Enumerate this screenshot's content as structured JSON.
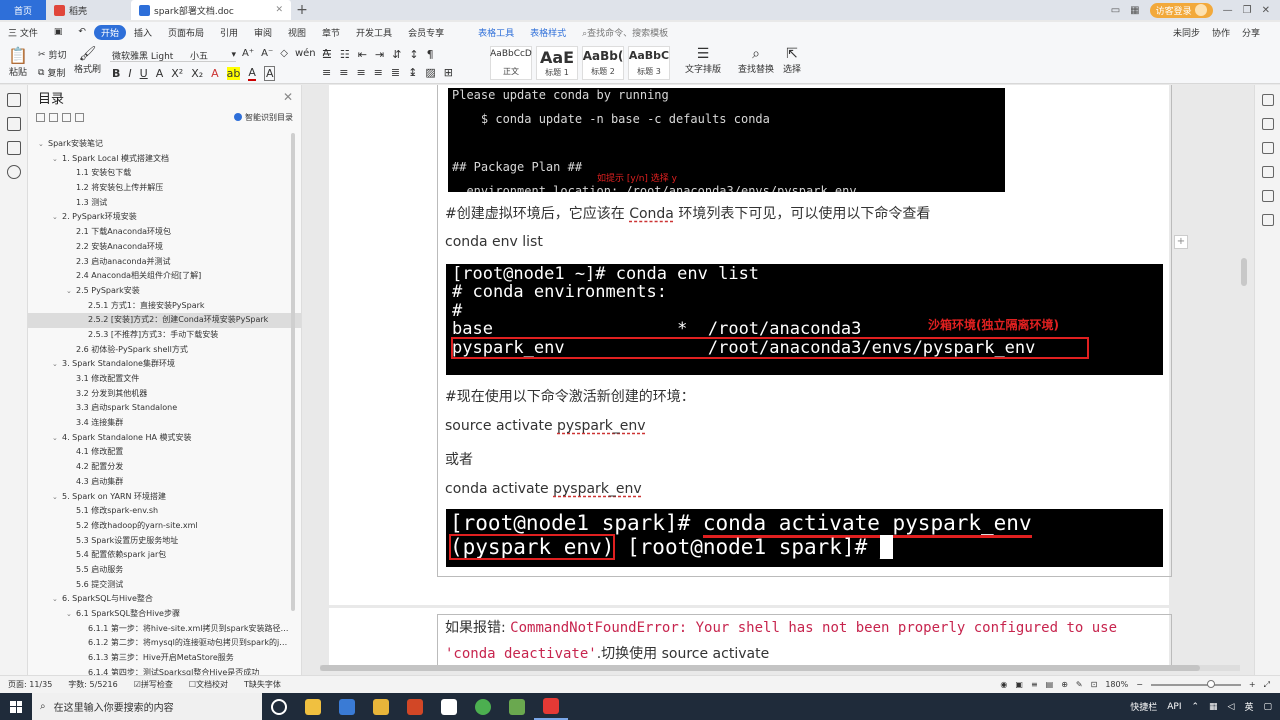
{
  "titlebar": {
    "tabs": [
      {
        "label": "首页"
      },
      {
        "label": "稻壳"
      },
      {
        "label": "spark部署文档.doc"
      }
    ],
    "login_label": "访客登录"
  },
  "menubar": {
    "file": "三 文件",
    "items": [
      "开始",
      "插入",
      "页面布局",
      "引用",
      "审阅",
      "视图",
      "章节",
      "开发工具",
      "会员专享"
    ],
    "active": "开始",
    "context_tabs": [
      "表格工具",
      "表格样式"
    ],
    "search_placeholder": "查找命令、搜索模板",
    "right": [
      "未同步",
      "协作",
      "分享"
    ]
  },
  "ribbon": {
    "paste": "粘贴",
    "cut": "剪切",
    "copy": "复制",
    "format_painter": "格式刷",
    "font_name": "微软雅黑 Light",
    "font_size": "小五",
    "styles": [
      {
        "preview": "AaBbCcD",
        "name": "正文"
      },
      {
        "preview": "AaE",
        "name": "标题 1"
      },
      {
        "preview": "AaBb(",
        "name": "标题 2"
      },
      {
        "preview": "AaBbC",
        "name": "标题 3"
      }
    ],
    "text_layout": "文字排版",
    "find_replace": "查找替换",
    "select": "选择"
  },
  "toc": {
    "title": "目录",
    "smart_label": "智能识别目录",
    "items": [
      {
        "text": "Spark安装笔记",
        "level": 0,
        "caret": "v"
      },
      {
        "text": "1. Spark Local 模式搭建文档",
        "level": 1,
        "caret": "v"
      },
      {
        "text": "1.1 安装包下载",
        "level": 2,
        "caret": ""
      },
      {
        "text": "1.2 将安装包上传并解压",
        "level": 2,
        "caret": ""
      },
      {
        "text": "1.3 测试",
        "level": 2,
        "caret": ""
      },
      {
        "text": "2. PySpark环境安装",
        "level": 1,
        "caret": "v"
      },
      {
        "text": "2.1 下载Anaconda环境包",
        "level": 2,
        "caret": ""
      },
      {
        "text": "2.2 安装Anaconda环境",
        "level": 2,
        "caret": ""
      },
      {
        "text": "2.3 启动anaconda并测试",
        "level": 2,
        "caret": ""
      },
      {
        "text": "2.4 Anaconda相关组件介绍[了解]",
        "level": 2,
        "caret": ""
      },
      {
        "text": "2.5 PySpark安装",
        "level": 2,
        "caret": "v"
      },
      {
        "text": "2.5.1 方式1：直接安装PySpark",
        "level": 3,
        "caret": ""
      },
      {
        "text": "2.5.2 [安装]方式2：创建Conda环境安装PySpark",
        "level": 3,
        "caret": "",
        "selected": true
      },
      {
        "text": "2.5.3 [不推荐]方式3：手动下载安装",
        "level": 3,
        "caret": ""
      },
      {
        "text": "2.6 初体验-PySpark shell方式",
        "level": 2,
        "caret": ""
      },
      {
        "text": "3. Spark Standalone集群环境",
        "level": 1,
        "caret": "v"
      },
      {
        "text": "3.1 修改配置文件",
        "level": 2,
        "caret": ""
      },
      {
        "text": "3.2 分发到其他机器",
        "level": 2,
        "caret": ""
      },
      {
        "text": "3.3 启动spark Standalone",
        "level": 2,
        "caret": ""
      },
      {
        "text": "3.4 连接集群",
        "level": 2,
        "caret": ""
      },
      {
        "text": "4. Spark Standalone HA 模式安装",
        "level": 1,
        "caret": "v"
      },
      {
        "text": "4.1 修改配置",
        "level": 2,
        "caret": ""
      },
      {
        "text": "4.2 配置分发",
        "level": 2,
        "caret": ""
      },
      {
        "text": "4.3 启动集群",
        "level": 2,
        "caret": ""
      },
      {
        "text": "5. Spark on YARN 环境搭建",
        "level": 1,
        "caret": "v"
      },
      {
        "text": "5.1 修改spark-env.sh",
        "level": 2,
        "caret": ""
      },
      {
        "text": "5.2 修改hadoop的yarn-site.xml",
        "level": 2,
        "caret": ""
      },
      {
        "text": "5.3 Spark设置历史服务地址",
        "level": 2,
        "caret": ""
      },
      {
        "text": "5.4 配置依赖spark jar包",
        "level": 2,
        "caret": ""
      },
      {
        "text": "5.5 启动服务",
        "level": 2,
        "caret": ""
      },
      {
        "text": "5.6 提交测试",
        "level": 2,
        "caret": ""
      },
      {
        "text": "6. SparkSQL与Hive整合",
        "level": 1,
        "caret": "v"
      },
      {
        "text": "6.1 SparkSQL整合Hive步骤",
        "level": 2,
        "caret": "v"
      },
      {
        "text": "6.1.1 第一步：将hive-site.xml拷贝到spark安装路径c...",
        "level": 3,
        "caret": ""
      },
      {
        "text": "6.1.2 第二步：将mysql的连接驱动包拷贝到spark的ja...",
        "level": 3,
        "caret": ""
      },
      {
        "text": "6.1.3 第三步：Hive开启MetaStore服务",
        "level": 3,
        "caret": ""
      },
      {
        "text": "6.1.4 第四步：测试Sparksql整合Hive是否成功",
        "level": 3,
        "caret": ""
      }
    ]
  },
  "doc": {
    "term1_lines": [
      "Please update conda by running",
      "    $ conda update -n base -c defaults conda",
      "",
      "",
      "## Package Plan ##",
      "  environment location: /root/anaconda3/envs/pyspark_env"
    ],
    "term1_note": "如提示 [y/n] 选择 y",
    "p1_before": "#创建虚拟环境后，它应该在 ",
    "p1_word": "Conda",
    "p1_after": " 环境列表下可见，可以使用以下命令查看",
    "p2": "conda env list",
    "term2_lines": [
      "[root@node1 ~]# conda env list",
      "# conda environments:",
      "#",
      "base                  *  /root/anaconda3",
      "pyspark_env              /root/anaconda3/envs/pyspark_env"
    ],
    "term2_note": "沙箱环境(独立隔离环境)",
    "p3": "#现在使用以下命令激活新创建的环境：",
    "p4_prefix": "source activate ",
    "p4_env": "pyspark_env",
    "p5": "或者",
    "p6_prefix": "conda activate ",
    "p6_env": "pyspark_env",
    "term3_prompt": "[root@node1 spark]# ",
    "term3_cmd": "conda activate pyspark_env",
    "term3_line2_env": "(pyspark_env)",
    "term3_line2_rest": " [root@node1 spark]# ",
    "err_prefix": "如果报错: ",
    "err_code1": "CommandNotFoundError: Your shell has not been properly configured to use",
    "err_code2": "'conda deactivate'",
    "err_suffix": ".切换使用  source activate"
  },
  "statusbar": {
    "page": "页面: 11/35",
    "words": "字数: 5/5216",
    "spell": "拼写检查",
    "proof": "文档校对",
    "missing_font": "缺失字体",
    "zoom": "180%"
  },
  "taskbar": {
    "search_placeholder": "在这里输入你要搜索的内容",
    "tray": [
      "快捷栏",
      "API"
    ]
  }
}
